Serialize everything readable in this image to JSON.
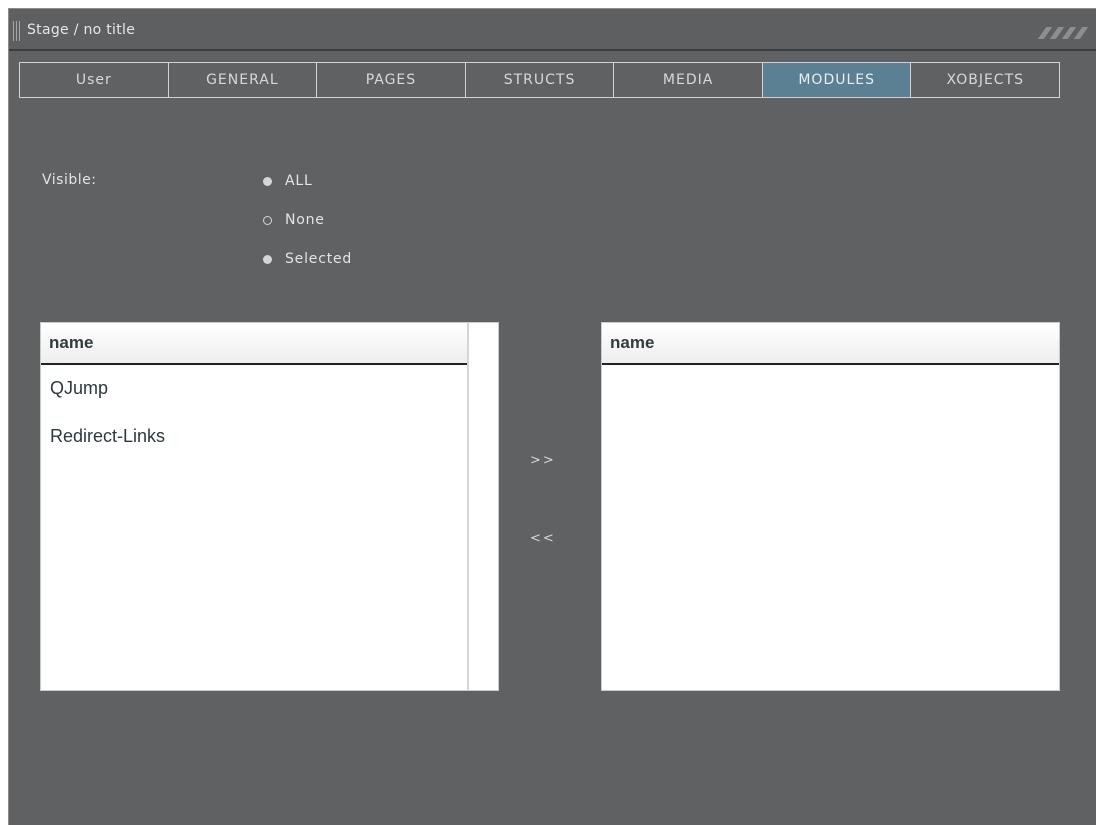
{
  "window": {
    "title": "Stage / no title"
  },
  "tabs": [
    {
      "label": "User"
    },
    {
      "label": "GENERAL"
    },
    {
      "label": "PAGES"
    },
    {
      "label": "STRUCTS"
    },
    {
      "label": "MEDIA"
    },
    {
      "label": "MODULES",
      "active": true
    },
    {
      "label": "XOBJECTS"
    }
  ],
  "visibility": {
    "label": "Visible:",
    "options": [
      {
        "label": "ALL",
        "icon": "radio-filled"
      },
      {
        "label": "None",
        "icon": "radio-empty"
      },
      {
        "label": "Selected",
        "icon": "radio-filled"
      }
    ]
  },
  "available_list": {
    "header": "name",
    "items": [
      "QJump",
      "Redirect-Links"
    ]
  },
  "selected_list": {
    "header": "name",
    "items": []
  },
  "buttons": {
    "add": ">>",
    "remove": "<<"
  },
  "colors": {
    "window_bg": "#5f6163",
    "active_tab": "#5b7f93",
    "text": "#e4e4e4"
  }
}
